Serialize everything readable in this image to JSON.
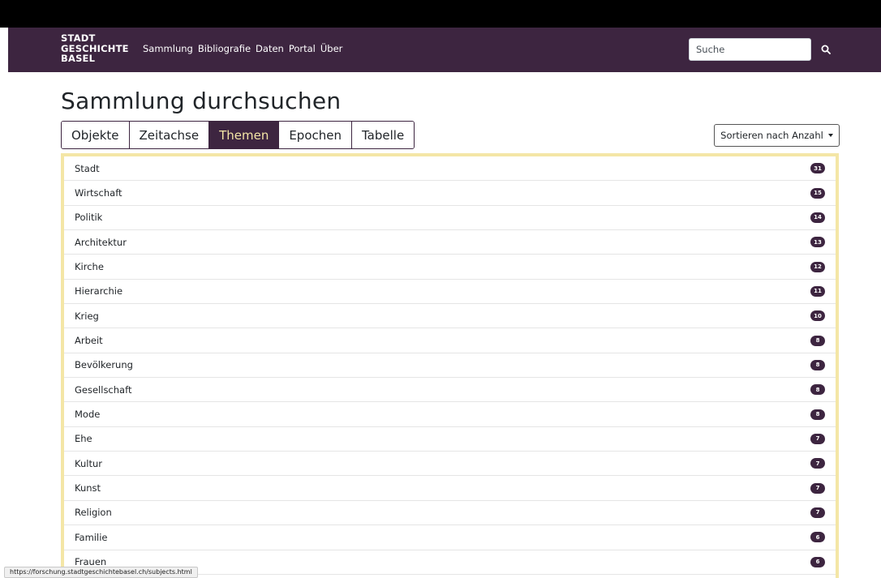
{
  "colors": {
    "brand": "#3d2540",
    "accent": "#f4e6a6"
  },
  "navbar": {
    "brand_lines": [
      "STADT",
      "GESCHICHTE",
      "BASEL"
    ],
    "links": [
      "Sammlung",
      "Bibliografie",
      "Daten",
      "Portal",
      "Über"
    ],
    "search_placeholder": "Suche",
    "search_icon": "search-icon"
  },
  "main": {
    "title": "Sammlung durchsuchen",
    "tabs": [
      {
        "label": "Objekte",
        "active": false
      },
      {
        "label": "Zeitachse",
        "active": false
      },
      {
        "label": "Themen",
        "active": true
      },
      {
        "label": "Epochen",
        "active": false
      },
      {
        "label": "Tabelle",
        "active": false
      }
    ],
    "sort_label": "Sortieren nach Anzahl",
    "items": [
      {
        "label": "Stadt",
        "count": "31"
      },
      {
        "label": "Wirtschaft",
        "count": "15"
      },
      {
        "label": "Politik",
        "count": "14"
      },
      {
        "label": "Architektur",
        "count": "13"
      },
      {
        "label": "Kirche",
        "count": "12"
      },
      {
        "label": "Hierarchie",
        "count": "11"
      },
      {
        "label": "Krieg",
        "count": "10"
      },
      {
        "label": "Arbeit",
        "count": "8"
      },
      {
        "label": "Bevölkerung",
        "count": "8"
      },
      {
        "label": "Gesellschaft",
        "count": "8"
      },
      {
        "label": "Mode",
        "count": "8"
      },
      {
        "label": "Ehe",
        "count": "7"
      },
      {
        "label": "Kultur",
        "count": "7"
      },
      {
        "label": "Kunst",
        "count": "7"
      },
      {
        "label": "Religion",
        "count": "7"
      },
      {
        "label": "Familie",
        "count": "6"
      },
      {
        "label": "Frauen",
        "count": "6"
      }
    ]
  },
  "statusbar": {
    "url": "https://forschung.stadtgeschichtebasel.ch/subjects.html"
  }
}
